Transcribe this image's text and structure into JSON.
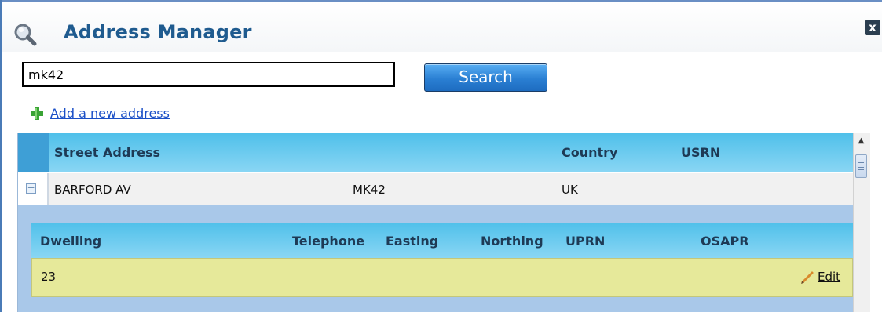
{
  "window": {
    "title": "Address Manager",
    "close_label": "x"
  },
  "search": {
    "value": "mk42",
    "button_label": "Search"
  },
  "add_address": {
    "label": "Add a new address"
  },
  "address_table": {
    "columns": [
      "Street Address",
      "Country",
      "USRN"
    ],
    "rows": [
      {
        "street": "BARFORD AV",
        "postcode": "MK42",
        "country": "UK",
        "usrn": ""
      }
    ]
  },
  "dwelling_table": {
    "columns": [
      "Dwelling",
      "Telephone",
      "Easting",
      "Northing",
      "UPRN",
      "OSAPR"
    ],
    "rows": [
      {
        "dwelling": "23",
        "telephone": "",
        "easting": "",
        "northing": "",
        "uprn": "",
        "osapr": "",
        "edit_label": "Edit"
      }
    ]
  },
  "icons": {
    "title": "magnifier-icon",
    "close": "close-icon",
    "add": "plus-icon",
    "expand": "minus-icon",
    "edit": "pencil-icon"
  },
  "colors": {
    "title_text": "#1f5b8f",
    "header_band": "#4fc0ea",
    "grid_background": "#a9c8e9",
    "detail_row": "#e6e99a",
    "search_button": "#2a7fd3",
    "link": "#1a4fc7"
  }
}
